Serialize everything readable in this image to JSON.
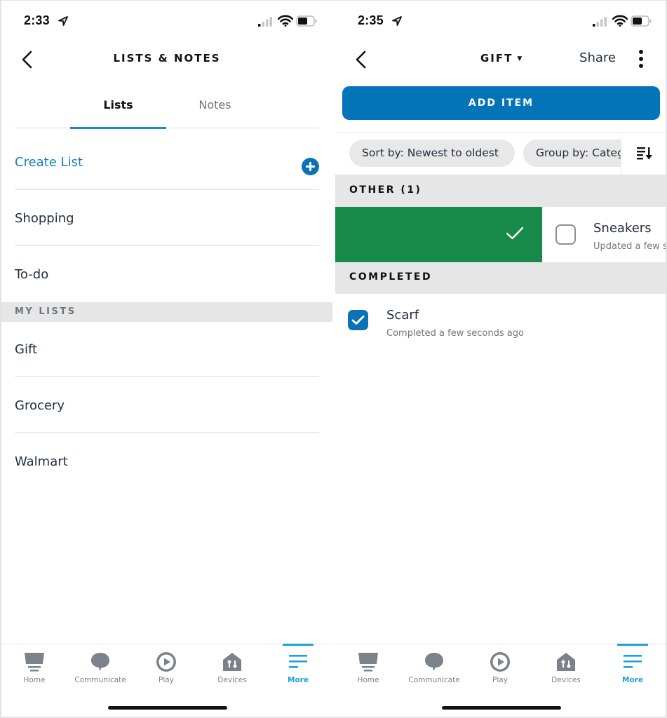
{
  "left_screen": {
    "status_bar": {
      "time": "2:33"
    },
    "header": {
      "title": "LISTS & NOTES"
    },
    "tabs": [
      {
        "label": "Lists",
        "active": true
      },
      {
        "label": "Notes",
        "active": false
      }
    ],
    "create_list": {
      "label": "Create List"
    },
    "default_lists": [
      {
        "label": "Shopping"
      },
      {
        "label": "To-do"
      }
    ],
    "my_lists_header": "MY LISTS",
    "my_lists": [
      {
        "label": "Gift"
      },
      {
        "label": "Grocery"
      },
      {
        "label": "Walmart"
      }
    ]
  },
  "right_screen": {
    "status_bar": {
      "time": "2:35"
    },
    "header": {
      "title": "GIFT",
      "caret": "▼",
      "share_label": "Share"
    },
    "add_item_label": "ADD ITEM",
    "filters": {
      "sort_label": "Sort by: Newest to oldest",
      "group_label": "Group by: Category"
    },
    "groups": [
      {
        "label": "OTHER (1)",
        "items": [
          {
            "name": "Sneakers",
            "subtitle": "Updated a few seconds ago",
            "checked": false
          }
        ]
      },
      {
        "label": "COMPLETED",
        "items": [
          {
            "name": "Scarf",
            "subtitle": "Completed a few seconds ago",
            "checked": true
          }
        ]
      }
    ]
  },
  "bottom_nav": [
    {
      "label": "Home",
      "icon": "home-icon",
      "active": false
    },
    {
      "label": "Communicate",
      "icon": "speech-bubble-icon",
      "active": false
    },
    {
      "label": "Play",
      "icon": "play-icon",
      "active": false
    },
    {
      "label": "Devices",
      "icon": "devices-icon",
      "active": false
    },
    {
      "label": "More",
      "icon": "menu-icon",
      "active": true
    }
  ],
  "colors": {
    "accent_blue": "#0474b8",
    "link_blue": "#1a7dbf",
    "nav_active": "#1da1de",
    "swipe_green": "#178a4a",
    "section_grey": "#e6e6e6"
  }
}
